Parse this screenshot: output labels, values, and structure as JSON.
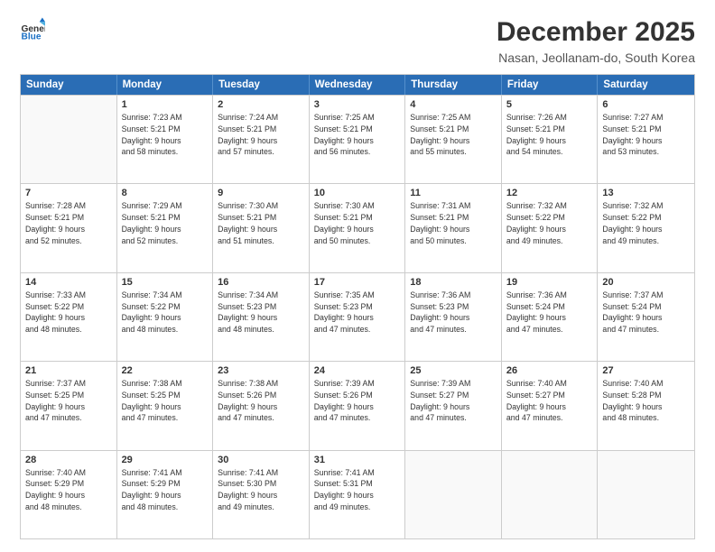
{
  "logo": {
    "line1": "General",
    "line2": "Blue"
  },
  "title": "December 2025",
  "subtitle": "Nasan, Jeollanam-do, South Korea",
  "header_days": [
    "Sunday",
    "Monday",
    "Tuesday",
    "Wednesday",
    "Thursday",
    "Friday",
    "Saturday"
  ],
  "weeks": [
    [
      {
        "day": "",
        "info": ""
      },
      {
        "day": "1",
        "info": "Sunrise: 7:23 AM\nSunset: 5:21 PM\nDaylight: 9 hours\nand 58 minutes."
      },
      {
        "day": "2",
        "info": "Sunrise: 7:24 AM\nSunset: 5:21 PM\nDaylight: 9 hours\nand 57 minutes."
      },
      {
        "day": "3",
        "info": "Sunrise: 7:25 AM\nSunset: 5:21 PM\nDaylight: 9 hours\nand 56 minutes."
      },
      {
        "day": "4",
        "info": "Sunrise: 7:25 AM\nSunset: 5:21 PM\nDaylight: 9 hours\nand 55 minutes."
      },
      {
        "day": "5",
        "info": "Sunrise: 7:26 AM\nSunset: 5:21 PM\nDaylight: 9 hours\nand 54 minutes."
      },
      {
        "day": "6",
        "info": "Sunrise: 7:27 AM\nSunset: 5:21 PM\nDaylight: 9 hours\nand 53 minutes."
      }
    ],
    [
      {
        "day": "7",
        "info": "Sunrise: 7:28 AM\nSunset: 5:21 PM\nDaylight: 9 hours\nand 52 minutes."
      },
      {
        "day": "8",
        "info": "Sunrise: 7:29 AM\nSunset: 5:21 PM\nDaylight: 9 hours\nand 52 minutes."
      },
      {
        "day": "9",
        "info": "Sunrise: 7:30 AM\nSunset: 5:21 PM\nDaylight: 9 hours\nand 51 minutes."
      },
      {
        "day": "10",
        "info": "Sunrise: 7:30 AM\nSunset: 5:21 PM\nDaylight: 9 hours\nand 50 minutes."
      },
      {
        "day": "11",
        "info": "Sunrise: 7:31 AM\nSunset: 5:21 PM\nDaylight: 9 hours\nand 50 minutes."
      },
      {
        "day": "12",
        "info": "Sunrise: 7:32 AM\nSunset: 5:22 PM\nDaylight: 9 hours\nand 49 minutes."
      },
      {
        "day": "13",
        "info": "Sunrise: 7:32 AM\nSunset: 5:22 PM\nDaylight: 9 hours\nand 49 minutes."
      }
    ],
    [
      {
        "day": "14",
        "info": "Sunrise: 7:33 AM\nSunset: 5:22 PM\nDaylight: 9 hours\nand 48 minutes."
      },
      {
        "day": "15",
        "info": "Sunrise: 7:34 AM\nSunset: 5:22 PM\nDaylight: 9 hours\nand 48 minutes."
      },
      {
        "day": "16",
        "info": "Sunrise: 7:34 AM\nSunset: 5:23 PM\nDaylight: 9 hours\nand 48 minutes."
      },
      {
        "day": "17",
        "info": "Sunrise: 7:35 AM\nSunset: 5:23 PM\nDaylight: 9 hours\nand 47 minutes."
      },
      {
        "day": "18",
        "info": "Sunrise: 7:36 AM\nSunset: 5:23 PM\nDaylight: 9 hours\nand 47 minutes."
      },
      {
        "day": "19",
        "info": "Sunrise: 7:36 AM\nSunset: 5:24 PM\nDaylight: 9 hours\nand 47 minutes."
      },
      {
        "day": "20",
        "info": "Sunrise: 7:37 AM\nSunset: 5:24 PM\nDaylight: 9 hours\nand 47 minutes."
      }
    ],
    [
      {
        "day": "21",
        "info": "Sunrise: 7:37 AM\nSunset: 5:25 PM\nDaylight: 9 hours\nand 47 minutes."
      },
      {
        "day": "22",
        "info": "Sunrise: 7:38 AM\nSunset: 5:25 PM\nDaylight: 9 hours\nand 47 minutes."
      },
      {
        "day": "23",
        "info": "Sunrise: 7:38 AM\nSunset: 5:26 PM\nDaylight: 9 hours\nand 47 minutes."
      },
      {
        "day": "24",
        "info": "Sunrise: 7:39 AM\nSunset: 5:26 PM\nDaylight: 9 hours\nand 47 minutes."
      },
      {
        "day": "25",
        "info": "Sunrise: 7:39 AM\nSunset: 5:27 PM\nDaylight: 9 hours\nand 47 minutes."
      },
      {
        "day": "26",
        "info": "Sunrise: 7:40 AM\nSunset: 5:27 PM\nDaylight: 9 hours\nand 47 minutes."
      },
      {
        "day": "27",
        "info": "Sunrise: 7:40 AM\nSunset: 5:28 PM\nDaylight: 9 hours\nand 48 minutes."
      }
    ],
    [
      {
        "day": "28",
        "info": "Sunrise: 7:40 AM\nSunset: 5:29 PM\nDaylight: 9 hours\nand 48 minutes."
      },
      {
        "day": "29",
        "info": "Sunrise: 7:41 AM\nSunset: 5:29 PM\nDaylight: 9 hours\nand 48 minutes."
      },
      {
        "day": "30",
        "info": "Sunrise: 7:41 AM\nSunset: 5:30 PM\nDaylight: 9 hours\nand 49 minutes."
      },
      {
        "day": "31",
        "info": "Sunrise: 7:41 AM\nSunset: 5:31 PM\nDaylight: 9 hours\nand 49 minutes."
      },
      {
        "day": "",
        "info": ""
      },
      {
        "day": "",
        "info": ""
      },
      {
        "day": "",
        "info": ""
      }
    ]
  ]
}
